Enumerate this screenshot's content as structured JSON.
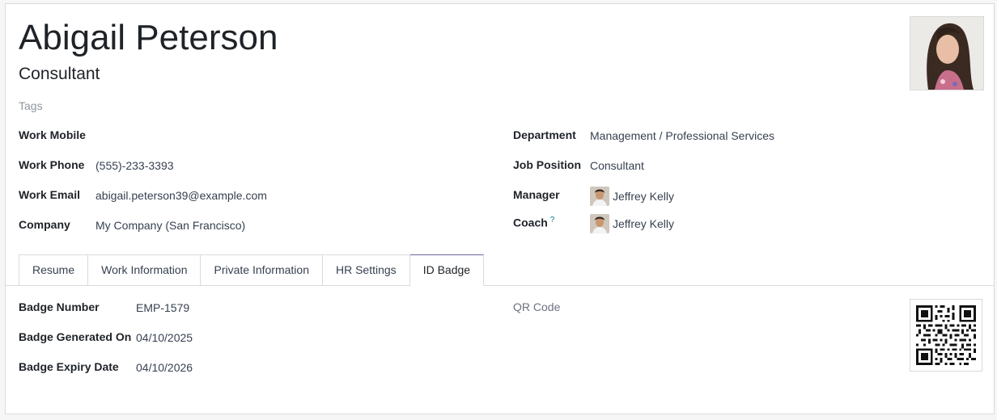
{
  "employee": {
    "name": "Abigail Peterson",
    "job_title": "Consultant",
    "tags_placeholder": "Tags"
  },
  "left_fields": [
    {
      "label": "Work Mobile",
      "value": ""
    },
    {
      "label": "Work Phone",
      "value": "(555)-233-3393"
    },
    {
      "label": "Work Email",
      "value": "abigail.peterson39@example.com"
    },
    {
      "label": "Company",
      "value": "My Company (San Francisco)"
    }
  ],
  "right_fields": {
    "department_label": "Department",
    "department_value": "Management / Professional Services",
    "job_position_label": "Job Position",
    "job_position_value": "Consultant",
    "manager_label": "Manager",
    "manager_value": "Jeffrey Kelly",
    "coach_label": "Coach",
    "coach_help": "?",
    "coach_value": "Jeffrey Kelly"
  },
  "tabs": [
    {
      "label": "Resume",
      "active": false
    },
    {
      "label": "Work Information",
      "active": false
    },
    {
      "label": "Private Information",
      "active": false
    },
    {
      "label": "HR Settings",
      "active": false
    },
    {
      "label": "ID Badge",
      "active": true
    }
  ],
  "id_badge": {
    "badge_number_label": "Badge Number",
    "badge_number_value": "EMP-1579",
    "generated_label": "Badge Generated On",
    "generated_value": "04/10/2025",
    "expiry_label": "Badge Expiry Date",
    "expiry_value": "04/10/2026",
    "qr_label": "QR Code"
  },
  "icons": {
    "employee_photo": "woman-portrait",
    "manager_avatar": "man-portrait",
    "qr": "qr-code"
  },
  "colors": {
    "accent": "#71639e",
    "help": "#017e84",
    "border": "#d8dadd"
  }
}
